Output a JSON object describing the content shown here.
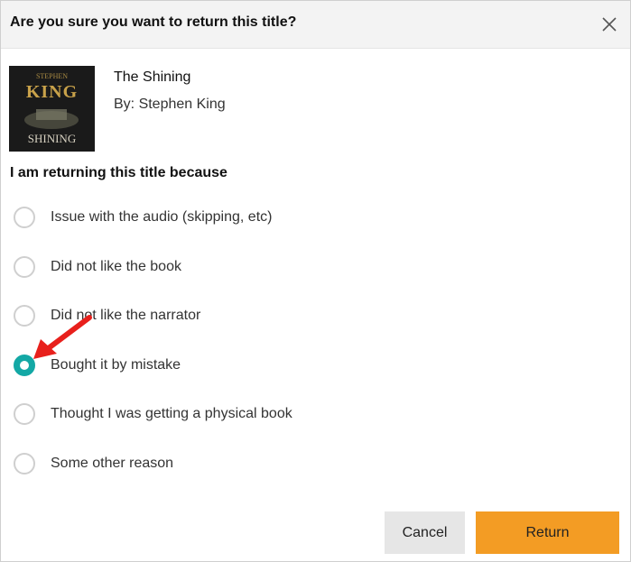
{
  "dialog": {
    "title": "Are you sure you want to return this title?",
    "close_icon": "close-icon"
  },
  "book": {
    "title": "The Shining",
    "author_line": "By: Stephen King",
    "cover": {
      "author_text": "KING",
      "top_text": "STEPHEN",
      "title_text": "SHINING"
    }
  },
  "reasons": {
    "heading": "I am returning this title because",
    "options": [
      {
        "label": "Issue with the audio (skipping, etc)",
        "selected": false
      },
      {
        "label": "Did not like the book",
        "selected": false
      },
      {
        "label": "Did not like the narrator",
        "selected": false
      },
      {
        "label": "Bought it by mistake",
        "selected": true
      },
      {
        "label": "Thought I was getting a physical book",
        "selected": false
      },
      {
        "label": "Some other reason",
        "selected": false
      }
    ]
  },
  "buttons": {
    "cancel": "Cancel",
    "return": "Return"
  },
  "colors": {
    "accent_radio": "#13a8a5",
    "return_button": "#f39c24",
    "annotation_arrow": "#e8201c"
  }
}
